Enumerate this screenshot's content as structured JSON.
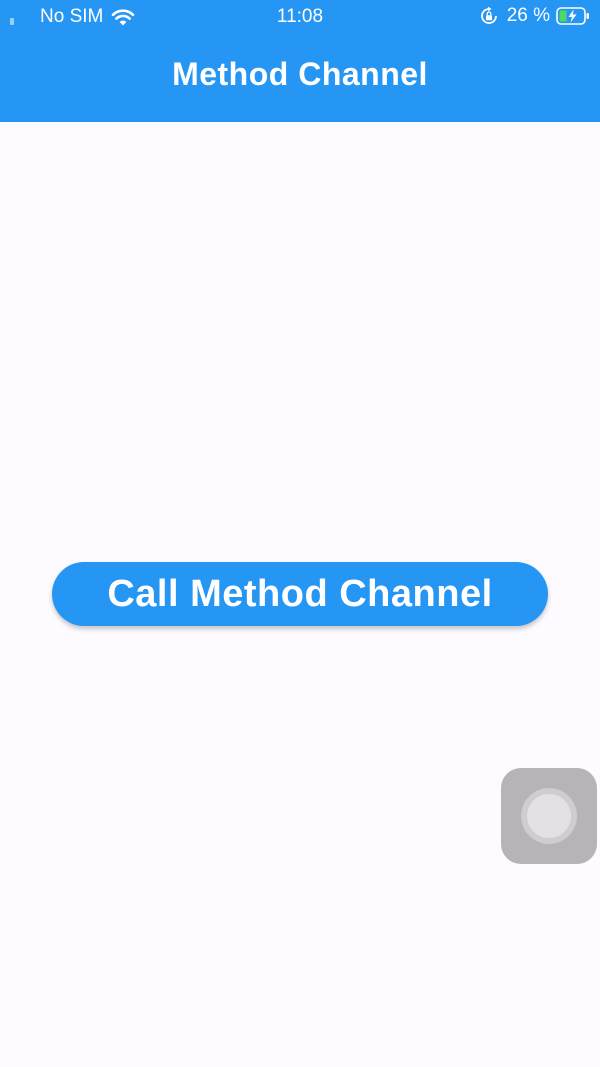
{
  "status_bar": {
    "carrier": "No SIM",
    "time": "11:08",
    "battery_percent": "26 %",
    "icons": [
      "signal-icon",
      "wifi-icon",
      "orientation-lock-icon",
      "battery-charging-icon"
    ]
  },
  "app_bar": {
    "title": "Method Channel"
  },
  "main": {
    "button_label": "Call Method Channel"
  },
  "overlay": {
    "assistive_touch_icon": "assistive-touch-icon"
  },
  "colors": {
    "primary": "#2596f3",
    "background": "#fdfbff",
    "on_primary": "#ffffff",
    "battery_charge": "#4cd964"
  }
}
